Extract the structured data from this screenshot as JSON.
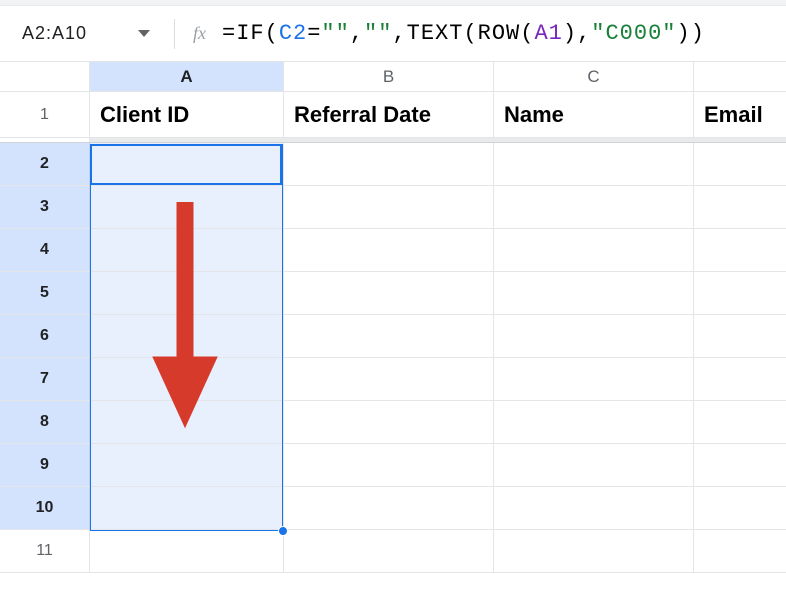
{
  "name_box": {
    "value": "A2:A10"
  },
  "fx_label": "fx",
  "formula": {
    "full": "=IF(C2=\"\",\"\",TEXT(ROW(A1),\"C000\"))",
    "tokens": [
      {
        "t": "=IF(",
        "c": "black"
      },
      {
        "t": "C2",
        "c": "blue"
      },
      {
        "t": "=",
        "c": "black"
      },
      {
        "t": "\"\"",
        "c": "green"
      },
      {
        "t": ",",
        "c": "black"
      },
      {
        "t": "\"\"",
        "c": "green"
      },
      {
        "t": ",TEXT(ROW(",
        "c": "black"
      },
      {
        "t": "A1",
        "c": "purple"
      },
      {
        "t": "),",
        "c": "black"
      },
      {
        "t": "\"C000\"",
        "c": "green"
      },
      {
        "t": "))",
        "c": "black"
      }
    ]
  },
  "columns": [
    {
      "id": "A",
      "label": "A",
      "selected": true
    },
    {
      "id": "B",
      "label": "B",
      "selected": false
    },
    {
      "id": "C",
      "label": "C",
      "selected": false
    },
    {
      "id": "D",
      "label": "",
      "selected": false
    }
  ],
  "rows": [
    {
      "n": "1",
      "selected": false
    },
    {
      "n": "2",
      "selected": true
    },
    {
      "n": "3",
      "selected": true
    },
    {
      "n": "4",
      "selected": true
    },
    {
      "n": "5",
      "selected": true
    },
    {
      "n": "6",
      "selected": true
    },
    {
      "n": "7",
      "selected": true
    },
    {
      "n": "8",
      "selected": true
    },
    {
      "n": "9",
      "selected": true
    },
    {
      "n": "10",
      "selected": true
    },
    {
      "n": "11",
      "selected": false
    }
  ],
  "header_cells": {
    "A": "Client ID",
    "B": "Referral Date",
    "C": "Name",
    "D": "Email"
  },
  "selection": {
    "range": "A2:A10",
    "active_cell": "A2"
  },
  "annotation": {
    "type": "arrow-down",
    "color": "#d63a2a"
  }
}
